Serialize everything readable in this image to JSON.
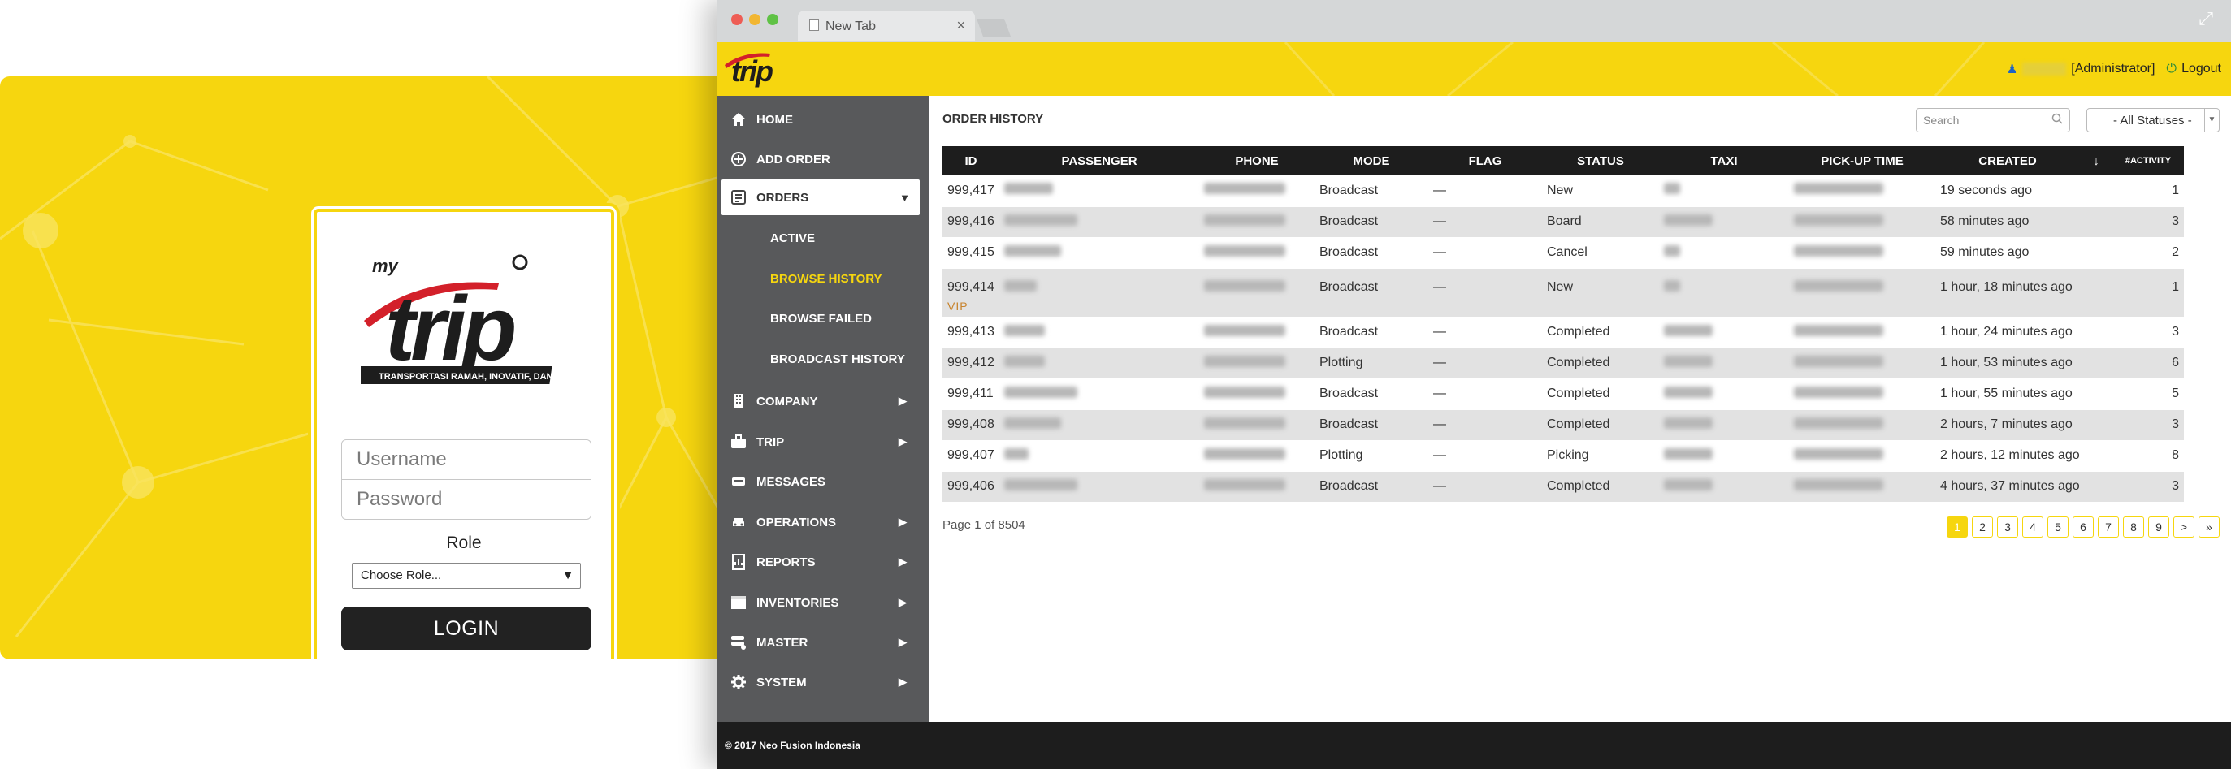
{
  "login": {
    "logo_word": "my trip",
    "tagline": "TRANSPORTASI RAMAH, INOVATIF, DAN PRAKTIS",
    "username_placeholder": "Username",
    "password_placeholder": "Password",
    "role_label": "Role",
    "role_selected": "Choose Role...",
    "login_button": "LOGIN"
  },
  "browser": {
    "tab_title": "New Tab",
    "tab_close": "×",
    "expand_icon": "⤢"
  },
  "header": {
    "logo_text": "trip",
    "role_text": "[Administrator]",
    "logout_label": "Logout"
  },
  "sidebar": {
    "items": [
      {
        "label": "HOME",
        "icon": "home-icon"
      },
      {
        "label": "ADD ORDER",
        "icon": "plus-circle-icon"
      },
      {
        "label": "ORDERS",
        "icon": "orders-icon",
        "arrow": "▼"
      },
      {
        "label": "COMPANY",
        "icon": "building-icon",
        "arrow": "▶"
      },
      {
        "label": "TRIP",
        "icon": "briefcase-icon",
        "arrow": "▶"
      },
      {
        "label": "MESSAGES",
        "icon": "message-icon"
      },
      {
        "label": "OPERATIONS",
        "icon": "car-icon",
        "arrow": "▶"
      },
      {
        "label": "REPORTS",
        "icon": "report-icon",
        "arrow": "▶"
      },
      {
        "label": "INVENTORIES",
        "icon": "inventory-icon",
        "arrow": "▶"
      },
      {
        "label": "MASTER",
        "icon": "database-icon",
        "arrow": "▶"
      },
      {
        "label": "SYSTEM",
        "icon": "gear-icon",
        "arrow": "▶"
      }
    ],
    "sub_items": [
      {
        "label": "ACTIVE"
      },
      {
        "label": "BROWSE HISTORY"
      },
      {
        "label": "BROWSE FAILED"
      },
      {
        "label": "BROADCAST HISTORY"
      }
    ]
  },
  "main": {
    "title": "ORDER HISTORY",
    "search_placeholder": "Search",
    "status_filter": "- All Statuses -",
    "columns": [
      "ID",
      "PASSENGER",
      "PHONE",
      "MODE",
      "FLAG",
      "STATUS",
      "TAXI",
      "PICK-UP TIME",
      "CREATED",
      "↓",
      "#ACTIVITY"
    ],
    "rows": [
      {
        "id": "999,417",
        "mode": "Broadcast",
        "flag": "—",
        "status": "New",
        "created": "19 seconds ago",
        "activity": "1"
      },
      {
        "id": "999,416",
        "mode": "Broadcast",
        "flag": "—",
        "status": "Board",
        "created": "58 minutes ago",
        "activity": "3"
      },
      {
        "id": "999,415",
        "mode": "Broadcast",
        "flag": "—",
        "status": "Cancel",
        "created": "59 minutes ago",
        "activity": "2"
      },
      {
        "id": "999,414",
        "vip": "VIP",
        "mode": "Broadcast",
        "flag": "—",
        "status": "New",
        "created": "1 hour, 18 minutes ago",
        "activity": "1"
      },
      {
        "id": "999,413",
        "mode": "Broadcast",
        "flag": "—",
        "status": "Completed",
        "created": "1 hour, 24 minutes ago",
        "activity": "3"
      },
      {
        "id": "999,412",
        "mode": "Plotting",
        "flag": "—",
        "status": "Completed",
        "created": "1 hour, 53 minutes ago",
        "activity": "6"
      },
      {
        "id": "999,411",
        "mode": "Broadcast",
        "flag": "—",
        "status": "Completed",
        "created": "1 hour, 55 minutes ago",
        "activity": "5"
      },
      {
        "id": "999,408",
        "mode": "Broadcast",
        "flag": "—",
        "status": "Completed",
        "created": "2 hours, 7 minutes ago",
        "activity": "3"
      },
      {
        "id": "999,407",
        "mode": "Plotting",
        "flag": "—",
        "status": "Picking",
        "created": "2 hours, 12 minutes ago",
        "activity": "8"
      },
      {
        "id": "999,406",
        "mode": "Broadcast",
        "flag": "—",
        "status": "Completed",
        "created": "4 hours, 37 minutes ago",
        "activity": "3"
      }
    ],
    "page_info": "Page 1 of 8504",
    "pages": [
      "1",
      "2",
      "3",
      "4",
      "5",
      "6",
      "7",
      "8",
      "9",
      ">",
      "»"
    ]
  },
  "footer": {
    "copyright": "© 2017 Neo Fusion Indonesia"
  },
  "colors": {
    "brand_yellow": "#f6d60f",
    "sidebar": "#58595b",
    "dark": "#1d1d1d",
    "vip": "#c8842e"
  }
}
